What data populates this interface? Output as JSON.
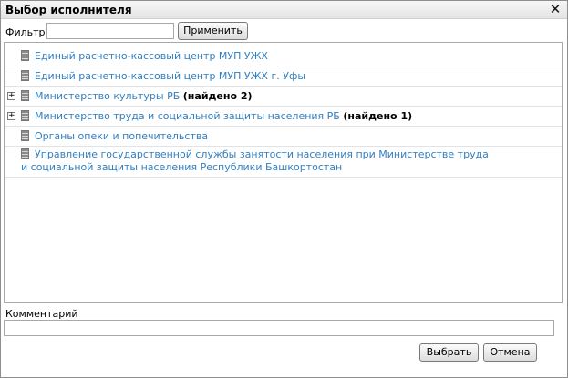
{
  "dialog": {
    "title": "Выбор исполнителя",
    "close_icon": "close-icon"
  },
  "filter": {
    "label": "Фильтр",
    "value": "",
    "placeholder": "",
    "apply_label": "Применить"
  },
  "tree": {
    "items": [
      {
        "label": "Единый расчетно-кассовый центр МУП УЖХ",
        "found": "",
        "expandable": false
      },
      {
        "label": "Единый расчетно-кассовый центр МУП УЖХ г. Уфы",
        "found": "",
        "expandable": false
      },
      {
        "label": "Министерство культуры РБ",
        "found": "(найдено 2)",
        "expandable": true
      },
      {
        "label": "Министерство труда и социальной защиты населения РБ",
        "found": "(найдено 1)",
        "expandable": true
      },
      {
        "label": "Органы опеки и попечительства",
        "found": "",
        "expandable": false
      },
      {
        "label": "Управление государственной службы занятости населения при Министерстве труда и социальной защиты населения Республики Башкортостан",
        "found": "",
        "expandable": false
      }
    ],
    "expander_symbol": "+",
    "node_icon": "building-icon",
    "link_color": "#2f7fc2"
  },
  "comment": {
    "label": "Комментарий",
    "value": "",
    "placeholder": ""
  },
  "buttons": {
    "select_label": "Выбрать",
    "cancel_label": "Отмена"
  }
}
